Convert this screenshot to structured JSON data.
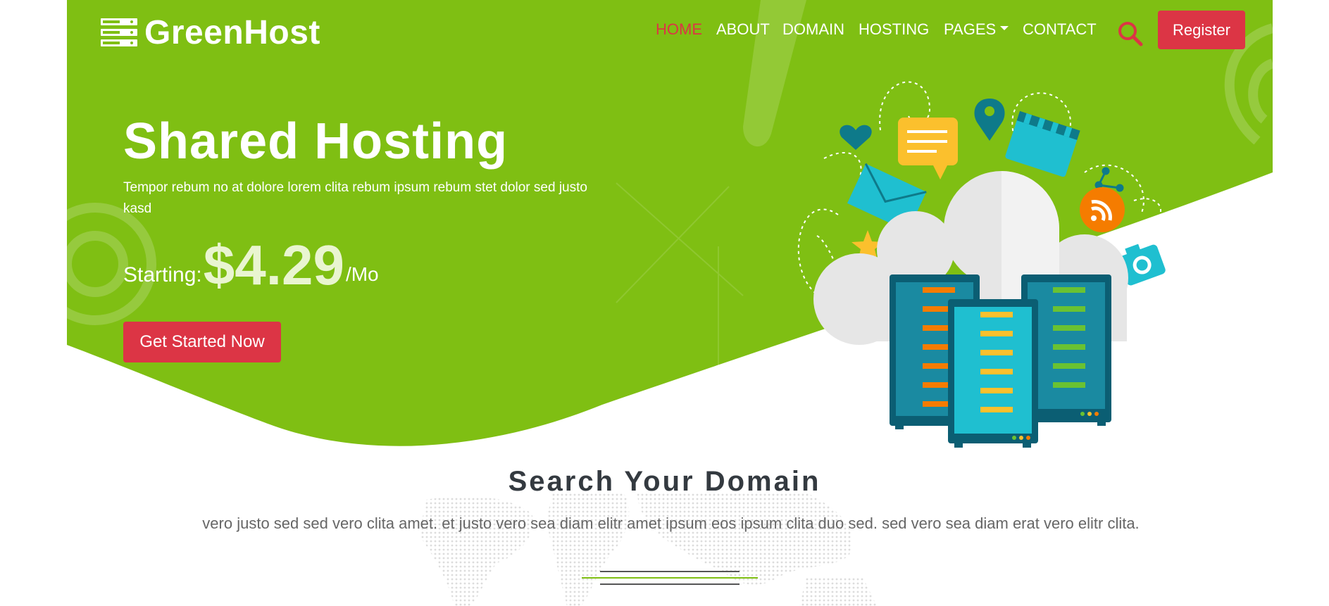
{
  "brand": {
    "name": "GreenHost",
    "icon": "server-stack-icon"
  },
  "colors": {
    "primary_green": "#7fbf13",
    "accent_red": "#dc3545",
    "white": "#ffffff",
    "heading_dark": "#343a40",
    "text_grey": "#666666"
  },
  "nav": {
    "items": [
      {
        "label": "HOME",
        "active": true
      },
      {
        "label": "ABOUT",
        "active": false
      },
      {
        "label": "DOMAIN",
        "active": false
      },
      {
        "label": "HOSTING",
        "active": false
      },
      {
        "label": "PAGES",
        "active": false,
        "dropdown": true
      },
      {
        "label": "CONTACT",
        "active": false
      }
    ],
    "search_icon": "search-icon",
    "register_label": "Register"
  },
  "hero": {
    "title": "Shared Hosting",
    "description": "Tempor rebum no at dolore lorem clita rebum ipsum rebum stet dolor sed justo kasd",
    "price_prefix": "Starting:",
    "price": "$4.29",
    "price_suffix": "/Mo",
    "cta_label": "Get Started Now",
    "illustration": "cloud-servers-illustration"
  },
  "domain_section": {
    "title": "Search Your Domain",
    "description": "vero justo sed sed vero clita amet. et justo vero sea diam elitr amet ipsum eos ipsum clita duo sed. sed vero sea diam erat vero elitr clita."
  }
}
